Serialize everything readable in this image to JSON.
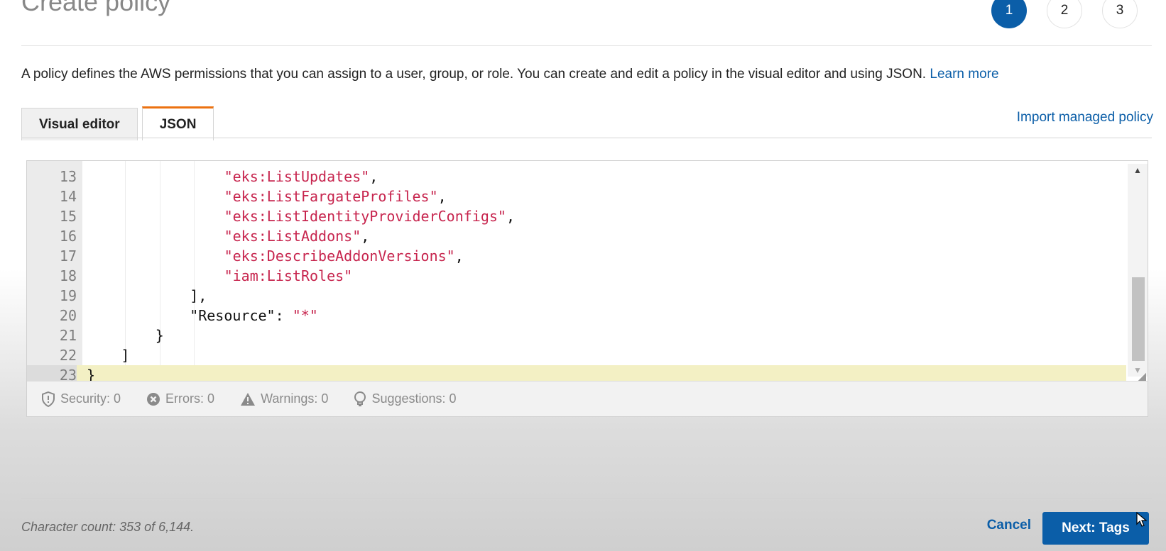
{
  "header": {
    "title": "Create policy"
  },
  "steps": [
    {
      "label": "1",
      "active": true
    },
    {
      "label": "2",
      "active": false
    },
    {
      "label": "3",
      "active": false
    }
  ],
  "intro": {
    "text": "A policy defines the AWS permissions that you can assign to a user, group, or role. You can create and edit a policy in the visual editor and using JSON.",
    "link": "Learn more"
  },
  "tabs": [
    {
      "label": "Visual editor",
      "active": false
    },
    {
      "label": "JSON",
      "active": true
    }
  ],
  "import_link": "Import managed policy",
  "editor": {
    "lines": [
      {
        "num": "13",
        "code": "\"eks:ListUpdates\",",
        "indent": 16
      },
      {
        "num": "14",
        "code": "\"eks:ListFargateProfiles\",",
        "indent": 16
      },
      {
        "num": "15",
        "code": "\"eks:ListIdentityProviderConfigs\",",
        "indent": 16
      },
      {
        "num": "16",
        "code": "\"eks:ListAddons\",",
        "indent": 16
      },
      {
        "num": "17",
        "code": "\"eks:DescribeAddonVersions\",",
        "indent": 16
      },
      {
        "num": "18",
        "code": "\"iam:ListRoles\"",
        "indent": 16
      },
      {
        "num": "19",
        "code": "],",
        "indent": 12
      },
      {
        "num": "20",
        "code": "\"Resource\": \"*\"",
        "indent": 12
      },
      {
        "num": "21",
        "code": "}",
        "indent": 8
      },
      {
        "num": "22",
        "code": "]",
        "indent": 4
      },
      {
        "num": "23",
        "code": "}",
        "indent": 0,
        "current": true
      }
    ]
  },
  "status": {
    "security": "Security: 0",
    "errors": "Errors: 0",
    "warnings": "Warnings: 0",
    "suggestions": "Suggestions: 0"
  },
  "footer": {
    "char_count": "Character count: 353 of 6,144.",
    "cancel": "Cancel",
    "next": "Next: Tags"
  },
  "colors": {
    "primary": "#0b5ea8",
    "tab_accent": "#ec7211",
    "string": "#c7254e",
    "current_line": "#f3f0c4"
  }
}
